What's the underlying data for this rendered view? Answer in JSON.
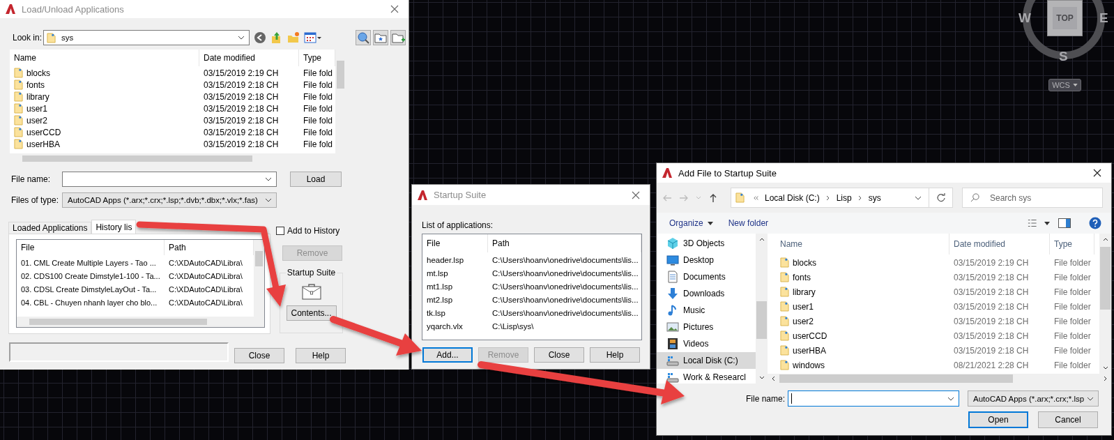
{
  "load_dialog": {
    "title": "Load/Unload Applications",
    "look_in_label": "Look in:",
    "look_in_value": "sys",
    "columns": [
      "Name",
      "Date modified",
      "Type"
    ],
    "files": [
      {
        "name": "blocks",
        "date": "03/15/2019 2:19 CH",
        "type": "File fold"
      },
      {
        "name": "fonts",
        "date": "03/15/2019 2:18 CH",
        "type": "File fold"
      },
      {
        "name": "library",
        "date": "03/15/2019 2:18 CH",
        "type": "File fold"
      },
      {
        "name": "user1",
        "date": "03/15/2019 2:18 CH",
        "type": "File fold"
      },
      {
        "name": "user2",
        "date": "03/15/2019 2:18 CH",
        "type": "File fold"
      },
      {
        "name": "userCCD",
        "date": "03/15/2019 2:18 CH",
        "type": "File fold"
      },
      {
        "name": "userHBA",
        "date": "03/15/2019 2:18 CH",
        "type": "File fold"
      }
    ],
    "file_name_label": "File name:",
    "files_of_type_label": "Files of type:",
    "files_of_type_value": "AutoCAD Apps (*.arx;*.crx;*.lsp;*.dvb;*.dbx;*.vlx;*.fas)",
    "load_button": "Load",
    "tabs": [
      {
        "label": "Loaded Applications",
        "selected": false
      },
      {
        "label": "History lis",
        "selected": true
      }
    ],
    "add_to_history": {
      "label": "Add to History",
      "checked": false
    },
    "remove_button": {
      "label": "Remove",
      "disabled": true
    },
    "history_columns": [
      "File",
      "Path"
    ],
    "history": [
      {
        "file": "01. CML Create Multiple Layers - Tao ...",
        "path": "C:\\XDAutoCAD\\Libra\\"
      },
      {
        "file": "02. CDS100 Create Dimstyle1-100 - Ta...",
        "path": "C:\\XDAutoCAD\\Libra\\"
      },
      {
        "file": "03. CDSL Create DimstyleLayOut - Ta...",
        "path": "C:\\XDAutoCAD\\Libra\\"
      },
      {
        "file": "04. CBL - Chuyen nhanh layer cho blo...",
        "path": "C:\\XDAutoCAD\\Libra\\"
      }
    ],
    "startup_suite_label": "Startup Suite",
    "contents_button": "Contents...",
    "buttons": [
      "Close",
      "Help"
    ]
  },
  "startup_dialog": {
    "title": "Startup Suite",
    "list_label": "List of applications:",
    "columns": [
      "File",
      "Path"
    ],
    "rows": [
      {
        "file": "header.lsp",
        "path": "C:\\Users\\hoanv\\onedrive\\documents\\lis..."
      },
      {
        "file": "mt.lsp",
        "path": "C:\\Users\\hoanv\\onedrive\\documents\\lis..."
      },
      {
        "file": "mt1.lsp",
        "path": "C:\\Users\\hoanv\\onedrive\\documents\\lis..."
      },
      {
        "file": "mt2.lsp",
        "path": "C:\\Users\\hoanv\\onedrive\\documents\\lis..."
      },
      {
        "file": "tk.lsp",
        "path": "C:\\Users\\hoanv\\onedrive\\documents\\lis..."
      },
      {
        "file": "yqarch.vlx",
        "path": "C:\\Lisp\\sys\\"
      }
    ],
    "buttons": [
      {
        "label": "Add...",
        "disabled": false,
        "focused": true
      },
      {
        "label": "Remove",
        "disabled": true,
        "focused": false
      },
      {
        "label": "Close",
        "disabled": false,
        "focused": false
      },
      {
        "label": "Help",
        "disabled": false,
        "focused": false
      }
    ]
  },
  "add_file_dialog": {
    "title": "Add File to Startup Suite",
    "breadcrumb": [
      "Local Disk (C:)",
      "Lisp",
      "sys"
    ],
    "search_placeholder": "Search sys",
    "toolbar": [
      "Organize",
      "New folder"
    ],
    "nav": [
      {
        "label": "3D Objects",
        "kind": "objects",
        "selected": false
      },
      {
        "label": "Desktop",
        "kind": "desktop",
        "selected": false
      },
      {
        "label": "Documents",
        "kind": "documents",
        "selected": false
      },
      {
        "label": "Downloads",
        "kind": "downloads",
        "selected": false
      },
      {
        "label": "Music",
        "kind": "music",
        "selected": false
      },
      {
        "label": "Pictures",
        "kind": "pictures",
        "selected": false
      },
      {
        "label": "Videos",
        "kind": "videos",
        "selected": false
      },
      {
        "label": "Local Disk (C:)",
        "kind": "drive",
        "selected": true
      },
      {
        "label": "Work & Researcl",
        "kind": "drive",
        "selected": false
      }
    ],
    "columns": [
      "Name",
      "Date modified",
      "Type"
    ],
    "files": [
      {
        "name": "blocks",
        "date": "03/15/2019 2:19 CH",
        "type": "File folder"
      },
      {
        "name": "fonts",
        "date": "03/15/2019 2:18 CH",
        "type": "File folder"
      },
      {
        "name": "library",
        "date": "03/15/2019 2:18 CH",
        "type": "File folder"
      },
      {
        "name": "user1",
        "date": "03/15/2019 2:18 CH",
        "type": "File folder"
      },
      {
        "name": "user2",
        "date": "03/15/2019 2:18 CH",
        "type": "File folder"
      },
      {
        "name": "userCCD",
        "date": "03/15/2019 2:18 CH",
        "type": "File folder"
      },
      {
        "name": "userHBA",
        "date": "03/15/2019 2:18 CH",
        "type": "File folder"
      },
      {
        "name": "windows",
        "date": "08/21/2021 2:28 CH",
        "type": "File folder"
      }
    ],
    "file_name_label": "File name:",
    "file_type_value": "AutoCAD Apps (*.arx;*.crx;*.lsp",
    "buttons": [
      {
        "label": "Open",
        "focused": true
      },
      {
        "label": "Cancel",
        "focused": false
      }
    ]
  },
  "view_cube": {
    "top": "TOP",
    "west": "W",
    "east": "E",
    "south": "S",
    "coordinate_system": "WCS"
  }
}
